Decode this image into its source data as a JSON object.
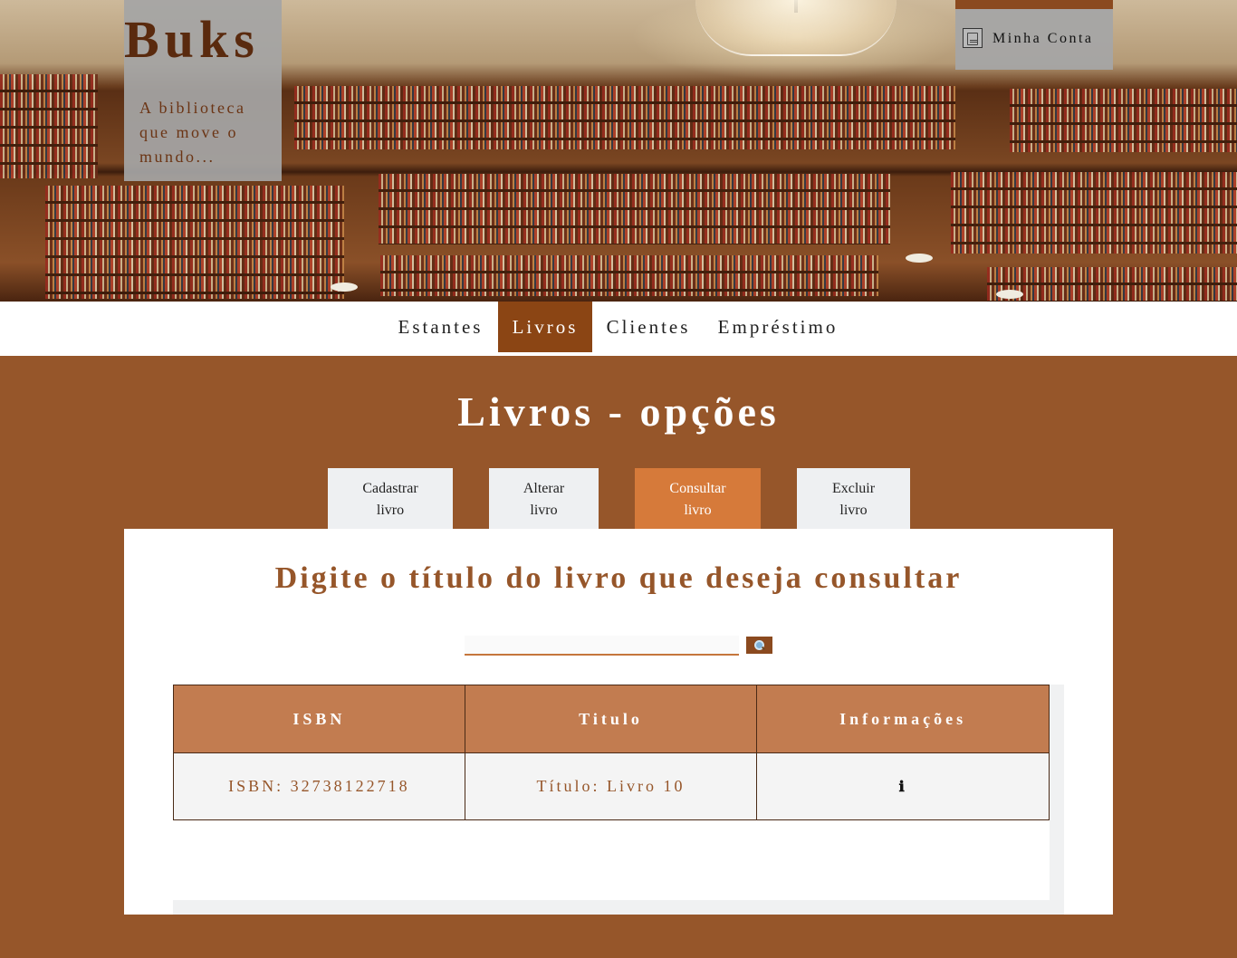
{
  "brand": {
    "title": "Buks",
    "tagline": "A biblioteca que move o mundo..."
  },
  "account": {
    "label": "Minha Conta",
    "icon": "account-icon"
  },
  "nav": {
    "items": [
      {
        "label": "Estantes",
        "active": false
      },
      {
        "label": "Livros",
        "active": true
      },
      {
        "label": "Clientes",
        "active": false
      },
      {
        "label": "Empréstimo",
        "active": false
      }
    ]
  },
  "main": {
    "title": "Livros - opções",
    "tabs": [
      {
        "line1": "Cadastrar",
        "line2": "livro",
        "active": false
      },
      {
        "line1": "Alterar",
        "line2": "livro",
        "active": false
      },
      {
        "line1": "Consultar",
        "line2": "livro",
        "active": true
      },
      {
        "line1": "Excluir",
        "line2": "livro",
        "active": false
      }
    ],
    "heading": "Digite o título do livro que deseja consultar",
    "search": {
      "value": "",
      "placeholder": "",
      "button_icon": "search-icon"
    },
    "table": {
      "headers": [
        "ISBN",
        "Titulo",
        "Informações"
      ],
      "rows": [
        {
          "isbn": "ISBN: 32738122718",
          "title": "Título: Livro 10",
          "info": "ℹ"
        }
      ]
    }
  },
  "colors": {
    "background": "#96562a",
    "accent": "#8b4514",
    "active_tab": "#d67a3a",
    "table_header": "#c27c50"
  }
}
